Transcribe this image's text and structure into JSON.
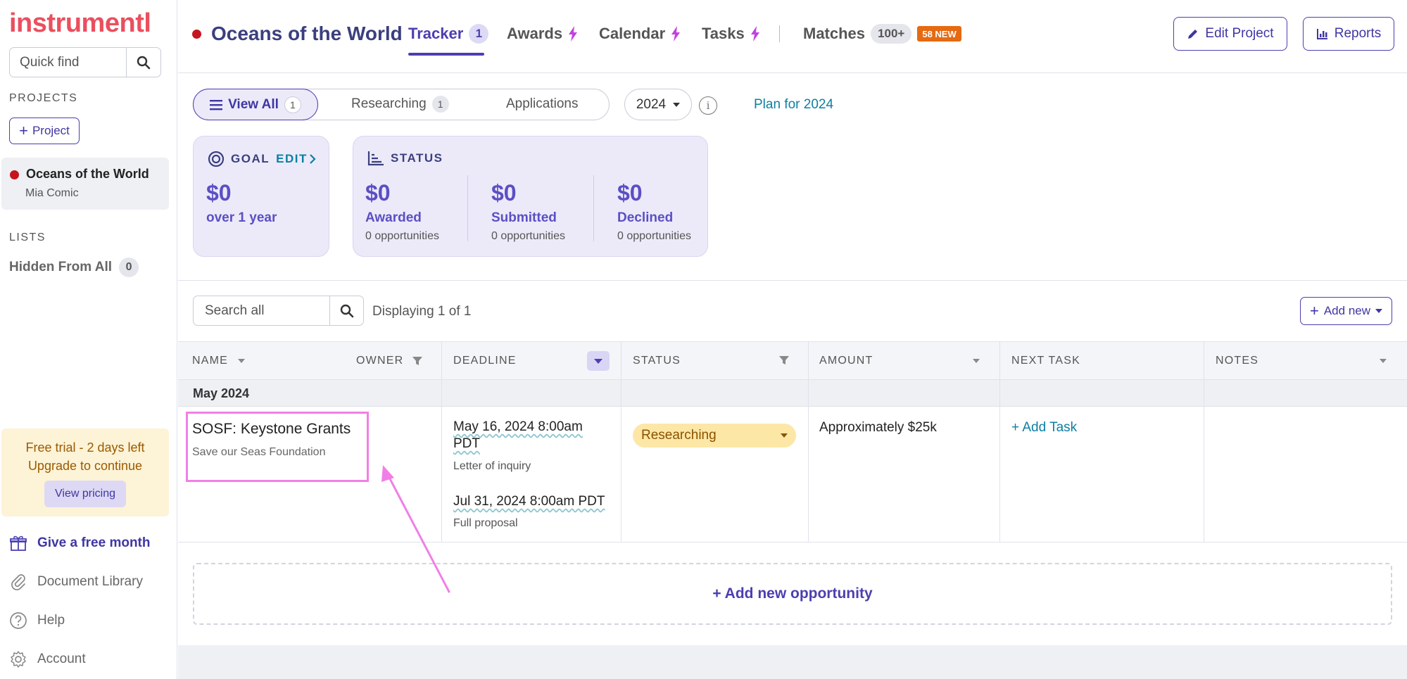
{
  "sidebar": {
    "logo": "instrumentl",
    "quick_find_placeholder": "Quick find",
    "projects_heading": "PROJECTS",
    "add_project_label": "Project",
    "project": {
      "name": "Oceans of the World",
      "owner": "Mia Comic"
    },
    "lists_heading": "LISTS",
    "hidden_list": {
      "label": "Hidden From All",
      "count": "0"
    },
    "trial": {
      "line1": "Free trial - 2 days left",
      "line2": "Upgrade to continue",
      "button": "View pricing"
    },
    "links": {
      "gift": "Give a free month",
      "docs": "Document Library",
      "help": "Help",
      "account": "Account"
    }
  },
  "header": {
    "project_title": "Oceans of the World",
    "tabs": {
      "tracker": {
        "label": "Tracker",
        "count": "1"
      },
      "awards": {
        "label": "Awards"
      },
      "calendar": {
        "label": "Calendar"
      },
      "tasks": {
        "label": "Tasks"
      },
      "matches": {
        "label": "Matches",
        "count": "100+",
        "new_badge": "58 NEW"
      }
    },
    "edit_project": "Edit Project",
    "reports": "Reports"
  },
  "filters": {
    "view_all": {
      "label": "View All",
      "count": "1"
    },
    "researching": {
      "label": "Researching",
      "count": "1"
    },
    "applications": {
      "label": "Applications"
    },
    "year": "2024",
    "info": "i",
    "plan_link": "Plan for 2024"
  },
  "goal_card": {
    "heading": "GOAL",
    "edit": "EDIT",
    "amount": "$0",
    "period": "over 1 year"
  },
  "status_card": {
    "heading": "STATUS",
    "cols": [
      {
        "amount": "$0",
        "label": "Awarded",
        "sub": "0 opportunities"
      },
      {
        "amount": "$0",
        "label": "Submitted",
        "sub": "0 opportunities"
      },
      {
        "amount": "$0",
        "label": "Declined",
        "sub": "0 opportunities"
      }
    ]
  },
  "table": {
    "search_placeholder": "Search all",
    "displaying": "Displaying 1 of 1",
    "add_new": "Add new",
    "columns": {
      "name": "NAME",
      "owner": "OWNER",
      "deadline": "DEADLINE",
      "status": "STATUS",
      "amount": "AMOUNT",
      "next_task": "NEXT TASK",
      "notes": "NOTES"
    },
    "group": "May 2024",
    "rows": [
      {
        "name": "SOSF: Keystone Grants",
        "funder": "Save our Seas Foundation",
        "deadlines": [
          {
            "date_line1": "May 16, 2024 8:00am",
            "date_line2": "PDT",
            "type": "Letter of inquiry"
          },
          {
            "date_line1": "Jul 31, 2024 8:00am PDT",
            "type": "Full proposal"
          }
        ],
        "status": "Researching",
        "amount": "Approximately $25k",
        "next_task": "+ Add Task"
      }
    ],
    "add_opportunity": "+ Add new opportunity"
  },
  "colors": {
    "accent": "#4b3fb0",
    "brand": "#ea4f5e",
    "highlight": "#f07fe7",
    "status_researching": "#fde7a6"
  }
}
